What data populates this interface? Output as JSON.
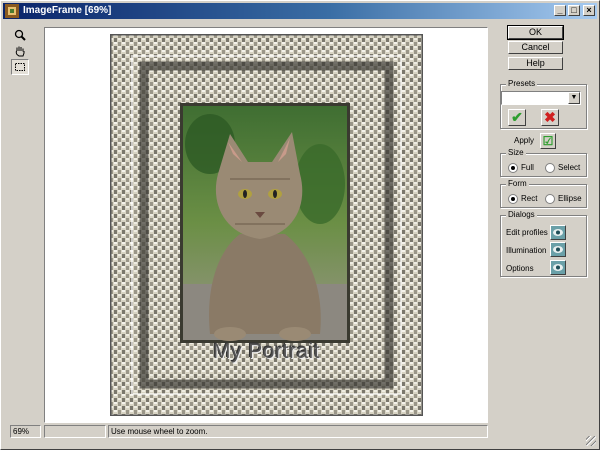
{
  "window": {
    "title": "ImageFrame [69%]"
  },
  "title_buttons": {
    "minimize": "_",
    "maximize": "□",
    "close": "×"
  },
  "tools": [
    {
      "name": "zoom-tool",
      "icon": "magnifier-icon"
    },
    {
      "name": "pan-tool",
      "icon": "hand-icon"
    },
    {
      "name": "select-tool",
      "icon": "marquee-icon"
    }
  ],
  "preview": {
    "caption": "My Portrait",
    "image": "cat-portrait-photo"
  },
  "buttons": {
    "ok": "OK",
    "cancel": "Cancel",
    "help": "Help"
  },
  "presets": {
    "title": "Presets",
    "value": "",
    "apply_icon": "check-icon",
    "delete_icon": "x-icon"
  },
  "apply": {
    "label": "Apply"
  },
  "size": {
    "title": "Size",
    "options": [
      "Full",
      "Select"
    ],
    "selected": "Full"
  },
  "form": {
    "title": "Form",
    "options": [
      "Rect",
      "Ellipse"
    ],
    "selected": "Rect"
  },
  "dialogs": {
    "title": "Dialogs",
    "items": [
      "Edit profiles",
      "Illumination",
      "Options"
    ],
    "icon": "eye-icon"
  },
  "status": {
    "zoom": "69%",
    "middle": "",
    "hint": "Use mouse wheel to zoom."
  },
  "colors": {
    "titlebar_start": "#0a246a",
    "titlebar_end": "#a6caf0",
    "face": "#d4d0c8",
    "ok_green": "#2e9e2e",
    "delete_red": "#d02020"
  }
}
